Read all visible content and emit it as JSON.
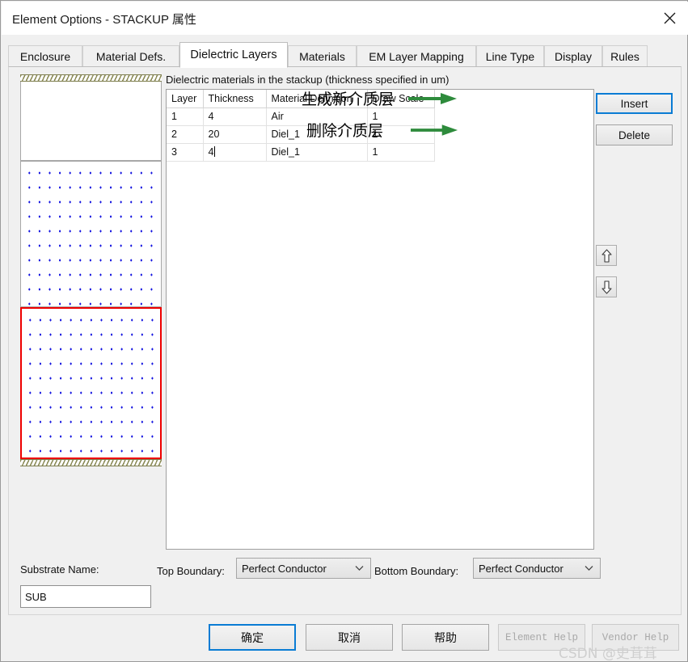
{
  "window": {
    "title": "Element Options - STACKUP 属性",
    "close_icon": "close-icon"
  },
  "tabs": [
    {
      "label": "Enclosure",
      "active": false
    },
    {
      "label": "Material Defs.",
      "active": false
    },
    {
      "label": "Dielectric Layers",
      "active": true
    },
    {
      "label": "Materials",
      "active": false
    },
    {
      "label": "EM Layer Mapping",
      "active": false
    },
    {
      "label": "Line Type",
      "active": false
    },
    {
      "label": "Display",
      "active": false
    },
    {
      "label": "Rules",
      "active": false
    }
  ],
  "table": {
    "caption": "Dielectric materials in the stackup (thickness specified in um)",
    "columns": [
      "Layer",
      "Thickness",
      "Material Definition",
      "Draw Scale"
    ],
    "rows": [
      {
        "layer": "1",
        "thickness": "4",
        "material": "Air",
        "draw_scale": "1",
        "editing": false
      },
      {
        "layer": "2",
        "thickness": "20",
        "material": "Diel_1",
        "draw_scale": "1",
        "editing": false
      },
      {
        "layer": "3",
        "thickness": "4",
        "material": "Diel_1",
        "draw_scale": "1",
        "editing": true
      }
    ]
  },
  "annotations": [
    {
      "text": "生成新介质层",
      "target": "Insert"
    },
    {
      "text": "删除介质层",
      "target": "Delete"
    }
  ],
  "side_buttons": {
    "insert_label": "Insert",
    "delete_label": "Delete",
    "move_up_icon": "arrow-up-icon",
    "move_down_icon": "arrow-down-icon"
  },
  "bottom_form": {
    "substrate_name_label": "Substrate Name:",
    "substrate_name_value": "SUB",
    "top_boundary_label": "Top Boundary:",
    "top_boundary_value": "Perfect Conductor",
    "bottom_boundary_label": "Bottom Boundary:",
    "bottom_boundary_value": "Perfect Conductor"
  },
  "footer": {
    "ok_label": "确定",
    "cancel_label": "取消",
    "help_label": "帮助",
    "element_help_label": "Element Help",
    "vendor_help_label": "Vendor Help"
  },
  "watermark": "CSDN @史茸茸",
  "colors": {
    "accent": "#0a7cd4",
    "selection_red": "#ee0000",
    "annotation_green": "#2e8b3c",
    "dielectric_dot": "#1414e0",
    "hatch_olive": "#8a8a55"
  }
}
